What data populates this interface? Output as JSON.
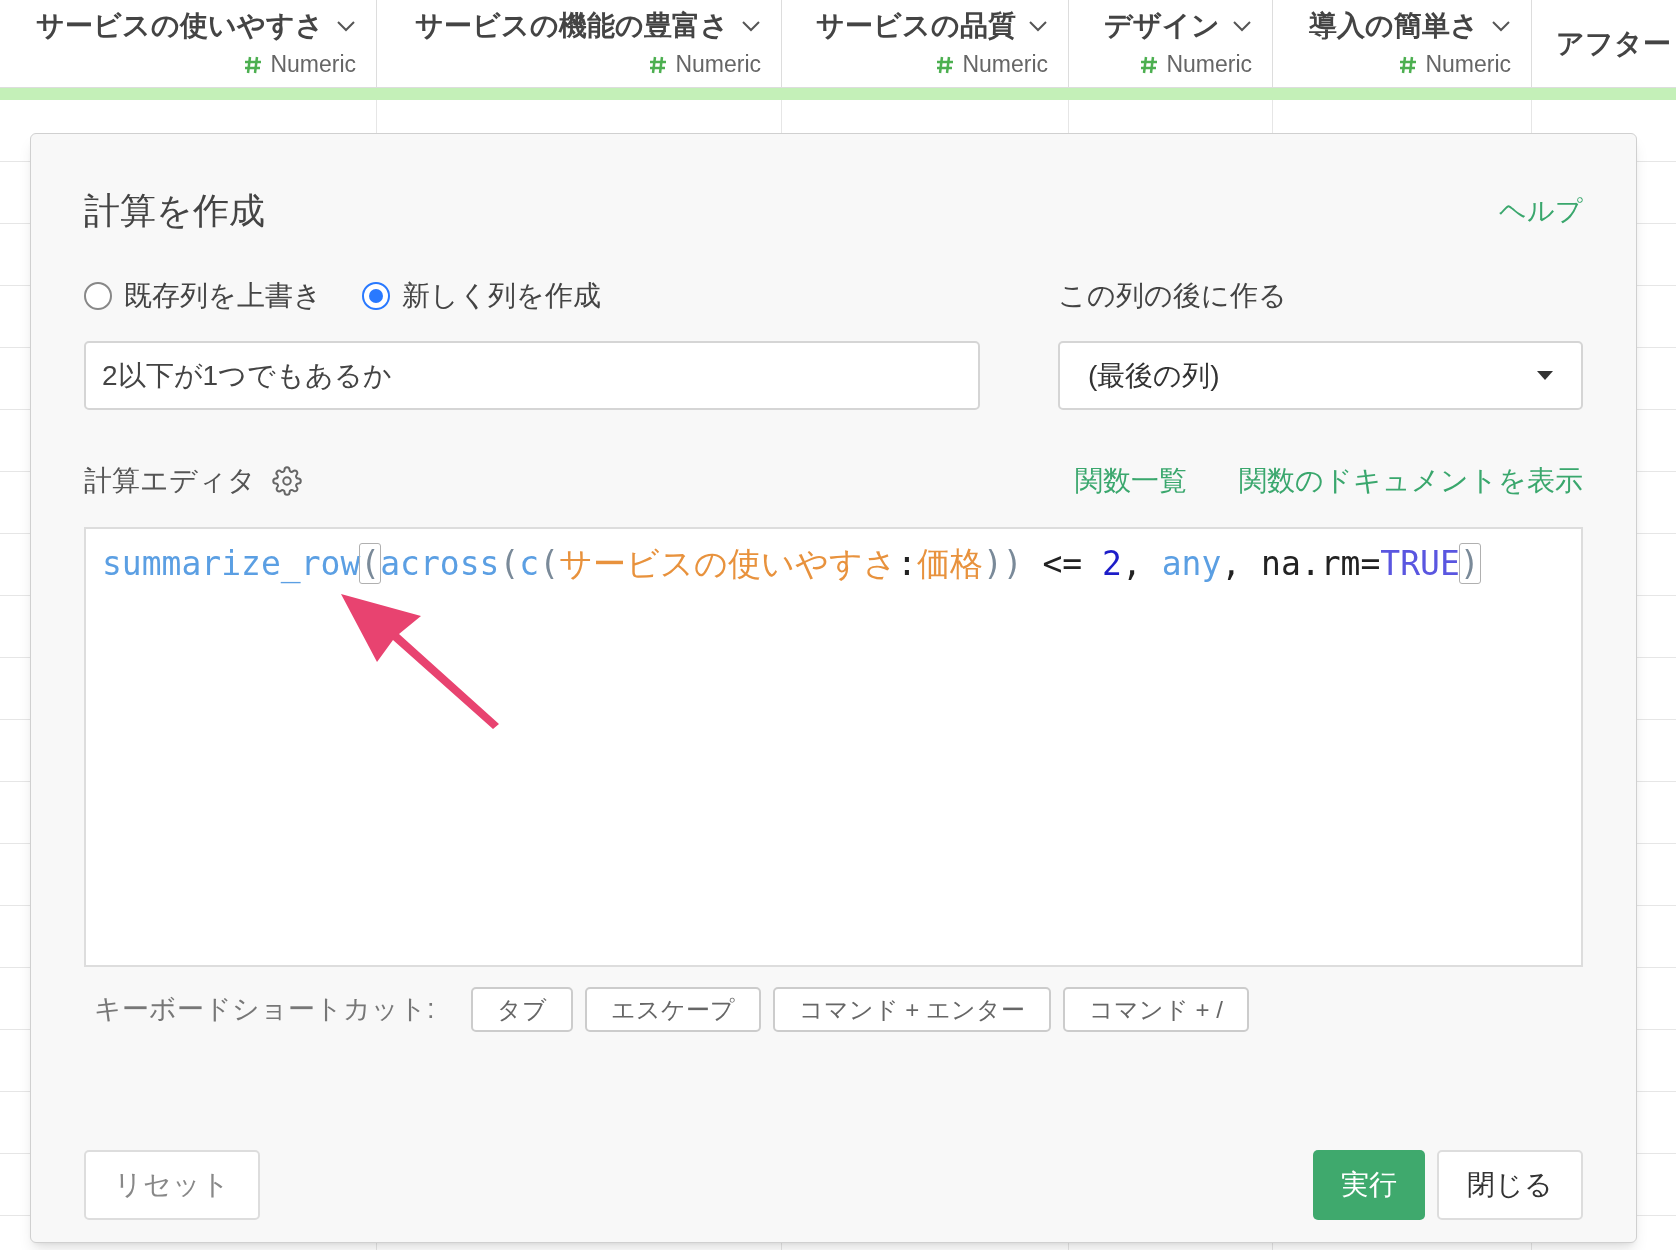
{
  "columns": [
    {
      "name": "サービスの使いやすさ",
      "type": "Numeric"
    },
    {
      "name": "サービスの機能の豊富さ",
      "type": "Numeric"
    },
    {
      "name": "サービスの品質",
      "type": "Numeric"
    },
    {
      "name": "デザイン",
      "type": "Numeric"
    },
    {
      "name": "導入の簡単さ",
      "type": "Numeric"
    },
    {
      "name": "アフター"
    }
  ],
  "dialog": {
    "title": "計算を作成",
    "help_link": "ヘルプ",
    "modes": [
      {
        "label": "既存列を上書き",
        "selected": false
      },
      {
        "label": "新しく列を作成",
        "selected": true
      }
    ],
    "column_name": "2以下が1つでもあるか",
    "position_label": "この列の後に作る",
    "position_value": "(最後の列)",
    "editor_label": "計算エディタ",
    "links": [
      "関数一覧",
      "関数のドキュメントを表示"
    ],
    "code": [
      {
        "text": "summarize_row",
        "kind": "function"
      },
      {
        "text": "(",
        "kind": "match"
      },
      {
        "text": "across",
        "kind": "function"
      },
      {
        "text": "(",
        "kind": "punct"
      },
      {
        "text": "c",
        "kind": "function"
      },
      {
        "text": "(",
        "kind": "punct"
      },
      {
        "text": "サービスの使いやすさ",
        "kind": "column"
      },
      {
        "text": ":",
        "kind": "plain"
      },
      {
        "text": "価格",
        "kind": "column"
      },
      {
        "text": "))",
        "kind": "punct"
      },
      {
        "text": " <= ",
        "kind": "plain"
      },
      {
        "text": "2",
        "kind": "number"
      },
      {
        "text": ", ",
        "kind": "plain"
      },
      {
        "text": "any",
        "kind": "function"
      },
      {
        "text": ", na.rm=",
        "kind": "plain"
      },
      {
        "text": "TRUE",
        "kind": "constant"
      },
      {
        "text": ")",
        "kind": "match"
      }
    ],
    "shortcuts_label": "キーボードショートカット:",
    "shortcuts": [
      "タブ",
      "エスケープ",
      "コマンド + エンター",
      "コマンド + /"
    ],
    "buttons": {
      "reset": "リセット",
      "run": "実行",
      "close": "閉じる"
    }
  }
}
